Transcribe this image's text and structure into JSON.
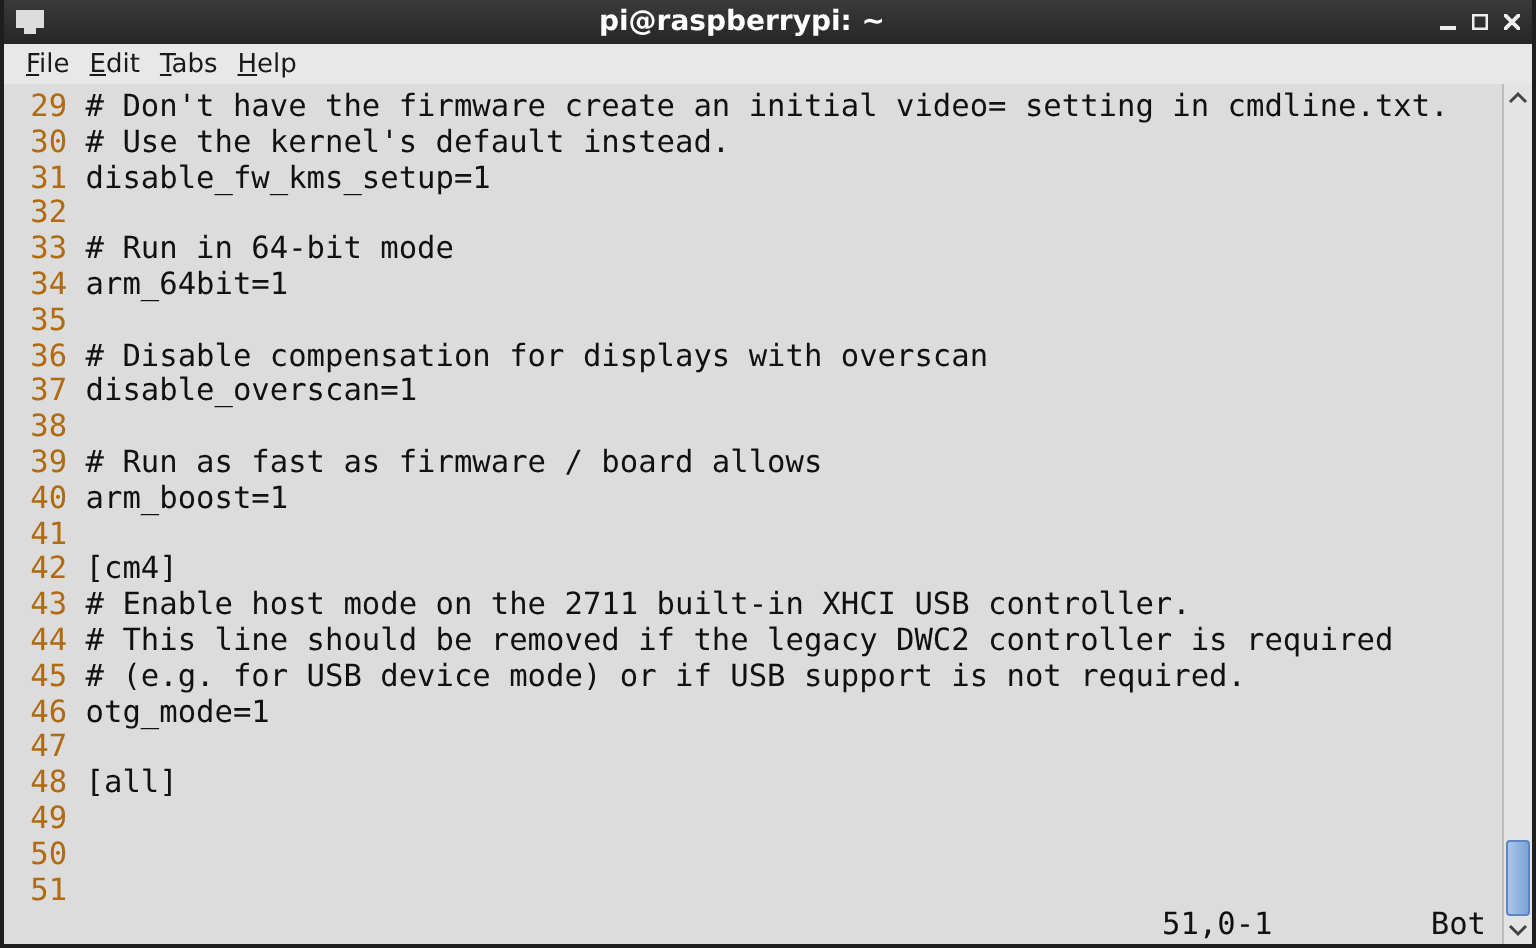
{
  "window": {
    "title": "pi@raspberrypi: ~"
  },
  "menu": [
    "File",
    "Edit",
    "Tabs",
    "Help"
  ],
  "lines": [
    {
      "number": "29",
      "text": "# Don't have the firmware create an initial video= setting in cmdline.txt."
    },
    {
      "number": "30",
      "text": "# Use the kernel's default instead."
    },
    {
      "number": "31",
      "text": "disable_fw_kms_setup=1"
    },
    {
      "number": "32"
    },
    {
      "number": "33",
      "text": "# Run in 64-bit mode"
    },
    {
      "number": "34",
      "text": "arm_64bit=1"
    },
    {
      "number": "35"
    },
    {
      "number": "36",
      "text": "# Disable compensation for displays with overscan"
    },
    {
      "number": "37",
      "text": "disable_overscan=1"
    },
    {
      "number": "38"
    },
    {
      "number": "39",
      "text": "# Run as fast as firmware / board allows"
    },
    {
      "number": "40",
      "text": "arm_boost=1"
    },
    {
      "number": "41"
    },
    {
      "number": "42",
      "text": "[cm4]"
    },
    {
      "number": "43",
      "text": "# Enable host mode on the 2711 built-in XHCI USB controller."
    },
    {
      "number": "44",
      "text": "# This line should be removed if the legacy DWC2 controller is required"
    },
    {
      "number": "45",
      "text": "# (e.g. for USB device mode) or if USB support is not required."
    },
    {
      "number": "46",
      "text": "otg_mode=1"
    },
    {
      "number": "47"
    },
    {
      "number": "48",
      "text": "[all]"
    },
    {
      "number": "49"
    },
    {
      "number": "50"
    },
    {
      "number": "51"
    }
  ],
  "status": {
    "position": "51,0-1",
    "scroll": "Bot"
  }
}
